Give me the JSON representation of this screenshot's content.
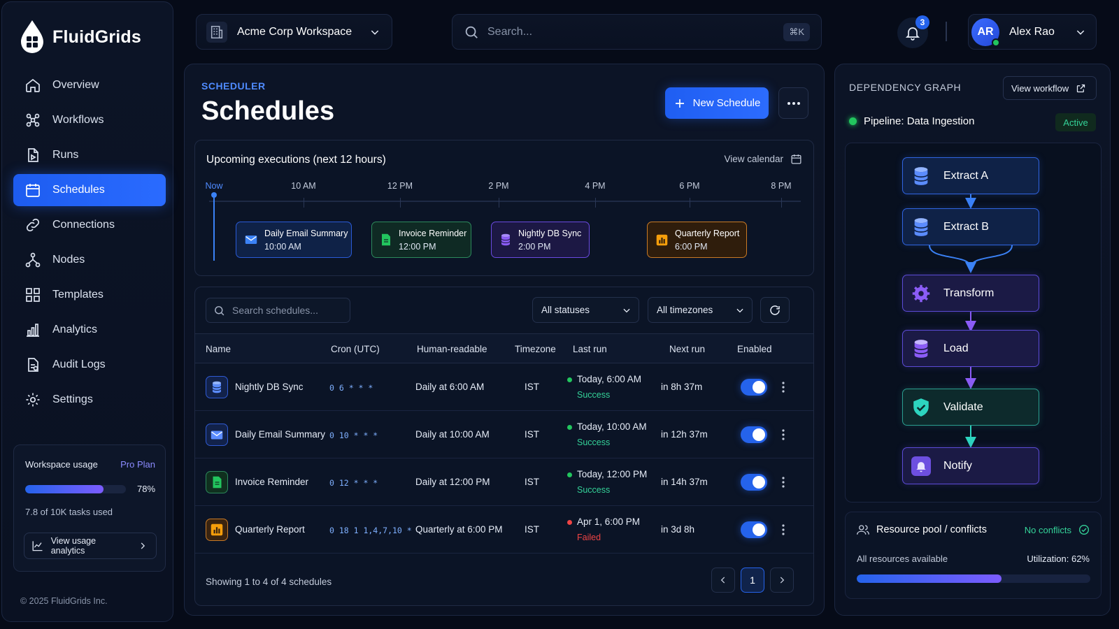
{
  "brand": {
    "name": "FluidGrids"
  },
  "nav": [
    {
      "label": "Overview",
      "icon": "home-icon"
    },
    {
      "label": "Workflows",
      "icon": "workflow-icon"
    },
    {
      "label": "Runs",
      "icon": "runs-icon"
    },
    {
      "label": "Schedules",
      "icon": "calendar-icon",
      "active": true
    },
    {
      "label": "Connections",
      "icon": "link-icon"
    },
    {
      "label": "Nodes",
      "icon": "nodes-icon"
    },
    {
      "label": "Templates",
      "icon": "templates-icon"
    },
    {
      "label": "Analytics",
      "icon": "analytics-icon"
    },
    {
      "label": "Audit Logs",
      "icon": "audit-icon"
    },
    {
      "label": "Settings",
      "icon": "gear-icon"
    }
  ],
  "usage": {
    "title": "Workspace usage",
    "plan": "Pro Plan",
    "percent_label": "78%",
    "percent": 78,
    "detail": "7.8 of 10K tasks used",
    "button": "View usage analytics"
  },
  "copyright": "© 2025 FluidGrids Inc.",
  "topbar": {
    "workspace": "Acme Corp Workspace",
    "search_placeholder": "Search...",
    "shortcut": "⌘K",
    "notifications": "3",
    "user_initials": "AR",
    "user_name": "Alex Rao"
  },
  "main": {
    "eyebrow": "SCHEDULER",
    "title": "Schedules",
    "new_button": "New Schedule"
  },
  "timeline": {
    "title": "Upcoming executions (next 12 hours)",
    "view_calendar": "View calendar",
    "labels": [
      "Now",
      "10 AM",
      "12 PM",
      "2 PM",
      "4 PM",
      "6 PM",
      "8 PM"
    ],
    "events": [
      {
        "name": "Daily Email Summary",
        "time": "10:00 AM",
        "color": "blue"
      },
      {
        "name": "Invoice Reminder",
        "time": "12:00 PM",
        "color": "green"
      },
      {
        "name": "Nightly DB Sync",
        "time": "2:00 PM",
        "color": "purple"
      },
      {
        "name": "Quarterly Report",
        "time": "6:00 PM",
        "color": "orange"
      }
    ]
  },
  "table": {
    "search_placeholder": "Search schedules...",
    "status_filter": "All statuses",
    "timezone_filter": "All timezones",
    "headers": [
      "Name",
      "Cron (UTC)",
      "Human-readable",
      "Timezone",
      "Last run",
      "Next run",
      "Enabled"
    ],
    "rows": [
      {
        "name": "Nightly DB Sync",
        "cron": "0 6 * * *",
        "human": "Daily at 6:00 AM",
        "tz": "IST",
        "last_run": "Today, 6:00 AM",
        "last_status": "Success",
        "next_run": "in 8h 37m",
        "enabled": true
      },
      {
        "name": "Daily Email Summary",
        "cron": "0 10 * * *",
        "human": "Daily at 10:00 AM",
        "tz": "IST",
        "last_run": "Today, 10:00 AM",
        "last_status": "Success",
        "next_run": "in 12h 37m",
        "enabled": true
      },
      {
        "name": "Invoice Reminder",
        "cron": "0 12 * * *",
        "human": "Daily at 12:00 PM",
        "tz": "IST",
        "last_run": "Today, 12:00 PM",
        "last_status": "Success",
        "next_run": "in 14h 37m",
        "enabled": true
      },
      {
        "name": "Quarterly Report",
        "cron": "0 18 1 1,4,7,10 *",
        "human": "Quarterly at 6:00 PM",
        "tz": "IST",
        "last_run": "Apr 1, 6:00 PM",
        "last_status": "Failed",
        "next_run": "in 3d 8h",
        "enabled": true
      }
    ],
    "footer": "Showing 1 to 4 of 4 schedules",
    "page": "1"
  },
  "graph": {
    "title": "DEPENDENCY GRAPH",
    "view_workflow": "View workflow",
    "pipeline": "Pipeline: Data Ingestion",
    "status": "Active",
    "nodes": [
      "Extract A",
      "Extract B",
      "Transform",
      "Load",
      "Validate",
      "Notify"
    ]
  },
  "resources": {
    "title": "Resource pool / conflicts",
    "status": "No conflicts",
    "detail": "All resources available",
    "utilization_label": "Utilization: 62%",
    "utilization": 62
  },
  "colors": {
    "accent": "#2563eb",
    "success": "#22c55e",
    "failed": "#ef4444",
    "purple": "#7c5cff",
    "orange": "#f59e0b"
  }
}
